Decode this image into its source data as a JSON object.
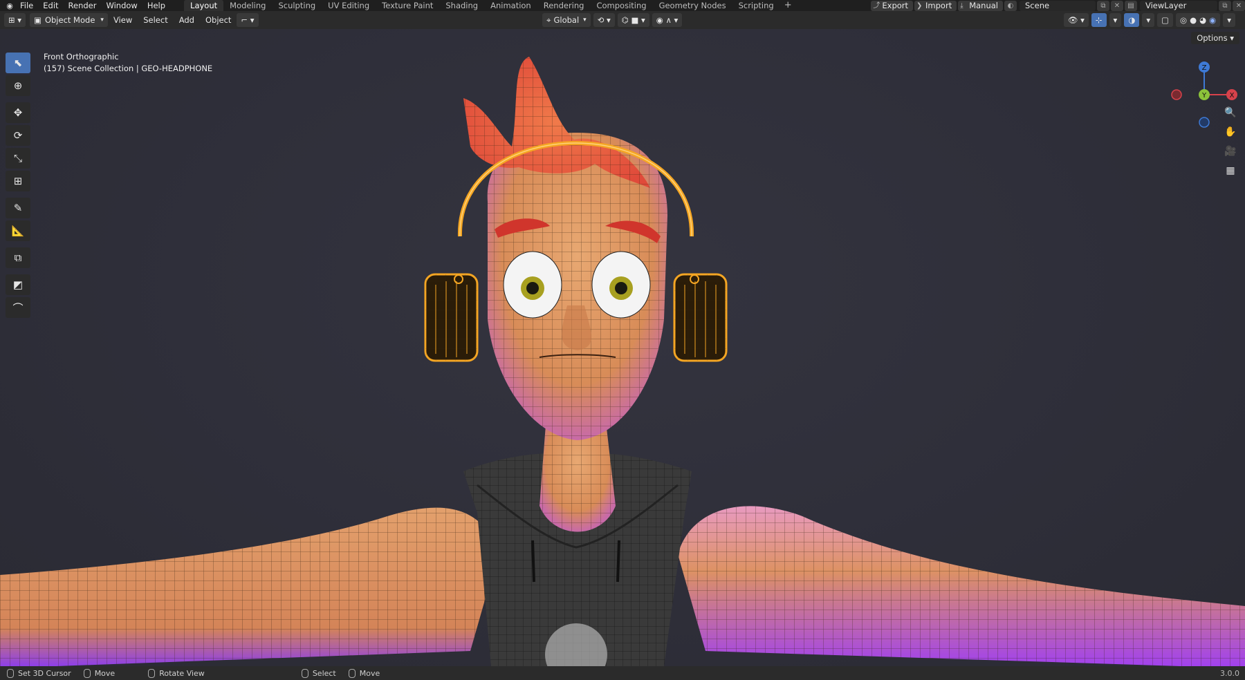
{
  "topbar": {
    "menus": [
      "File",
      "Edit",
      "Render",
      "Window",
      "Help"
    ],
    "workspaces": [
      "Layout",
      "Modeling",
      "Sculpting",
      "UV Editing",
      "Texture Paint",
      "Shading",
      "Animation",
      "Rendering",
      "Compositing",
      "Geometry Nodes",
      "Scripting"
    ],
    "active_workspace": "Layout",
    "add_workspace": "+",
    "export_label": "Export",
    "import_label": "Import",
    "manual_label": "Manual",
    "scene_name": "Scene",
    "view_layer": "ViewLayer"
  },
  "header": {
    "mode": "Object Mode",
    "menus": [
      "View",
      "Select",
      "Add",
      "Object"
    ],
    "transform_orientation": "Global",
    "options_label": "Options"
  },
  "viewport": {
    "view_name": "Front Orthographic",
    "collection_info": "(157) Scene Collection | GEO-HEADPHONE",
    "gizmo": {
      "x": "X",
      "y": "Y",
      "z": "Z"
    }
  },
  "toolbar": {
    "tools": [
      "select-box",
      "cursor",
      "move",
      "rotate",
      "scale",
      "transform",
      "annotate",
      "measure",
      "add-cube",
      "shear",
      "bend"
    ]
  },
  "statusbar": {
    "items": [
      "Set 3D Cursor",
      "Move",
      "Rotate View",
      "Select",
      "Move"
    ],
    "version": "3.0.0"
  },
  "colors": {
    "accent": "#4772b3",
    "gizmo_x": "#d7424b",
    "gizmo_y": "#8bc33a",
    "gizmo_z": "#3e7ad6",
    "selection": "#f5a623"
  }
}
